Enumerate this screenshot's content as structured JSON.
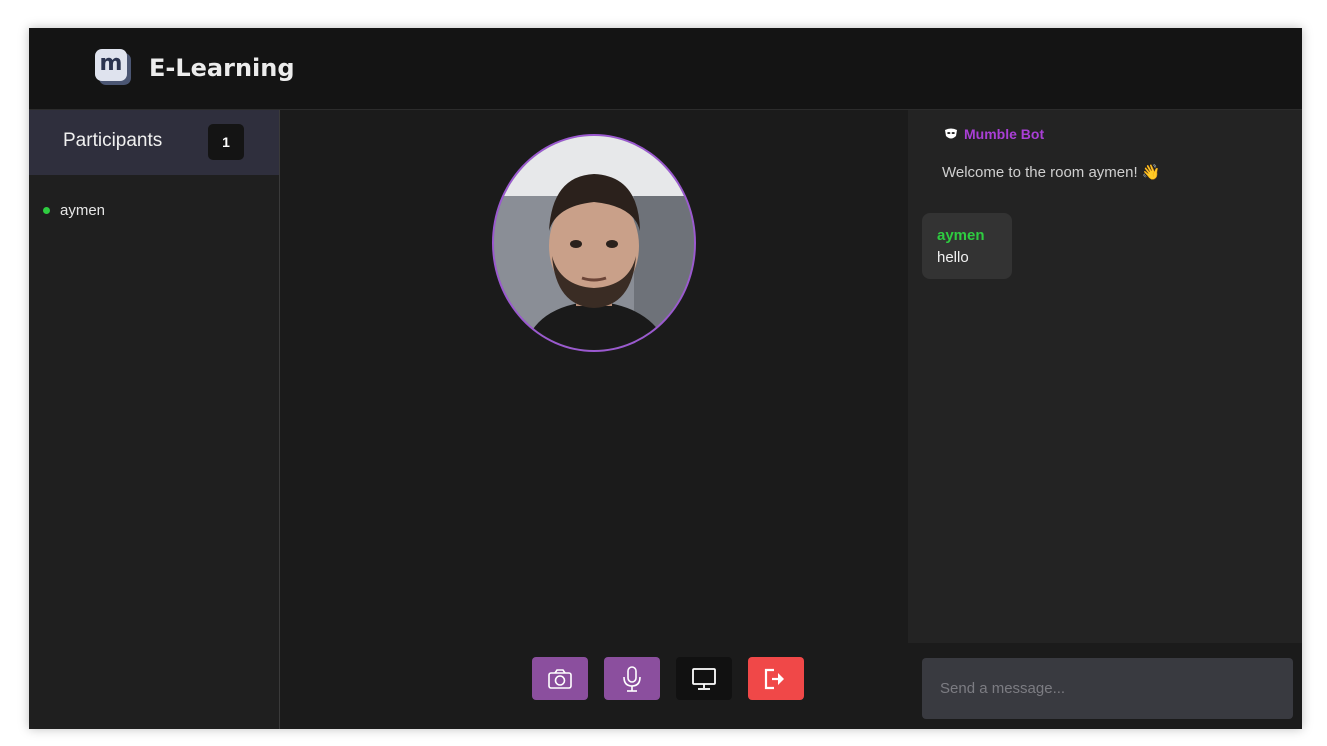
{
  "app": {
    "logo_letter": "m",
    "title": "E-Learning"
  },
  "sidebar": {
    "title": "Participants",
    "count": "1",
    "participants": [
      {
        "name": "aymen",
        "status": "online"
      }
    ]
  },
  "controls": {
    "camera": "camera-icon",
    "microphone": "microphone-icon",
    "screen_share": "monitor-icon",
    "leave": "exit-icon"
  },
  "chat": {
    "bot_name": "Mumble Bot",
    "bot_message": "Welcome to the room aymen! 👋",
    "messages": [
      {
        "author": "aymen",
        "text": "hello"
      }
    ],
    "input_placeholder": "Send a message..."
  },
  "colors": {
    "accent": "#8b4f9e",
    "bot": "#a93fd6",
    "online": "#2ecc40",
    "leave": "#f04848"
  }
}
